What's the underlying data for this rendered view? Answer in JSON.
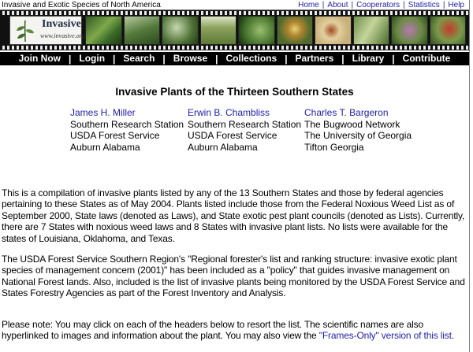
{
  "header": {
    "site_name": "Invasive and Exotic Species of North America",
    "links": [
      "Home",
      "About",
      "Cooperators",
      "Statistics",
      "Help"
    ]
  },
  "banner": {
    "logo_word": "Invasive",
    "logo_url": "www.invasive.org"
  },
  "nav": {
    "items": [
      "Join Now",
      "Login",
      "Search",
      "Browse",
      "Collections",
      "Partners",
      "Library",
      "Contribute"
    ]
  },
  "page": {
    "title": "Invasive Plants of the Thirteen Southern States"
  },
  "authors": [
    {
      "name": "James H. Miller",
      "line1": "Southern Research Station",
      "line2": "USDA Forest Service",
      "line3": "Auburn Alabama"
    },
    {
      "name": "Erwin B. Chambliss",
      "line1": "Southern Research Station",
      "line2": "USDA Forest Service",
      "line3": "Auburn Alabama"
    },
    {
      "name": "Charles T. Bargeron",
      "line1": "The Bugwood Network",
      "line2": "The University of Georgia",
      "line3": "Tifton Georgia"
    }
  ],
  "paragraphs": {
    "p1": "This is a compilation of invasive plants listed by any of the 13 Southern States and those by federal agencies pertaining to these States as of May 2004. Plants listed include those from the Federal Noxious Weed List as of September 2000, State laws (denoted as Laws), and State exotic pest plant councils (denoted as Lists). Currently, there are 7 States with noxious weed laws and 8 States with invasive plant lists. No lists were available for the states of Louisiana, Oklahoma, and Texas.",
    "p2": "The USDA Forest Service Southern Region's \"Regional forester's list and ranking structure: invasive exotic plant species of management concern (2001)\" has been included as a \"policy\" that guides invasive management on National Forest lands. Also, included is the list of invasive plants being monitored by the USDA Forest Service and States Forestry Agencies as part of the Forest Inventory and Analysis.",
    "p3_before": "Please note: You may click on each of the headers below to resort the list. The scientific names are also hyperlinked to images and information about the plant. You may also view the ",
    "p3_link": "\"Frames-Only\" version of this list.",
    "p3_after": ""
  },
  "colors": {
    "link": "#1f1faa",
    "nav_bg": "#000000",
    "nav_text": "#ffffff"
  }
}
